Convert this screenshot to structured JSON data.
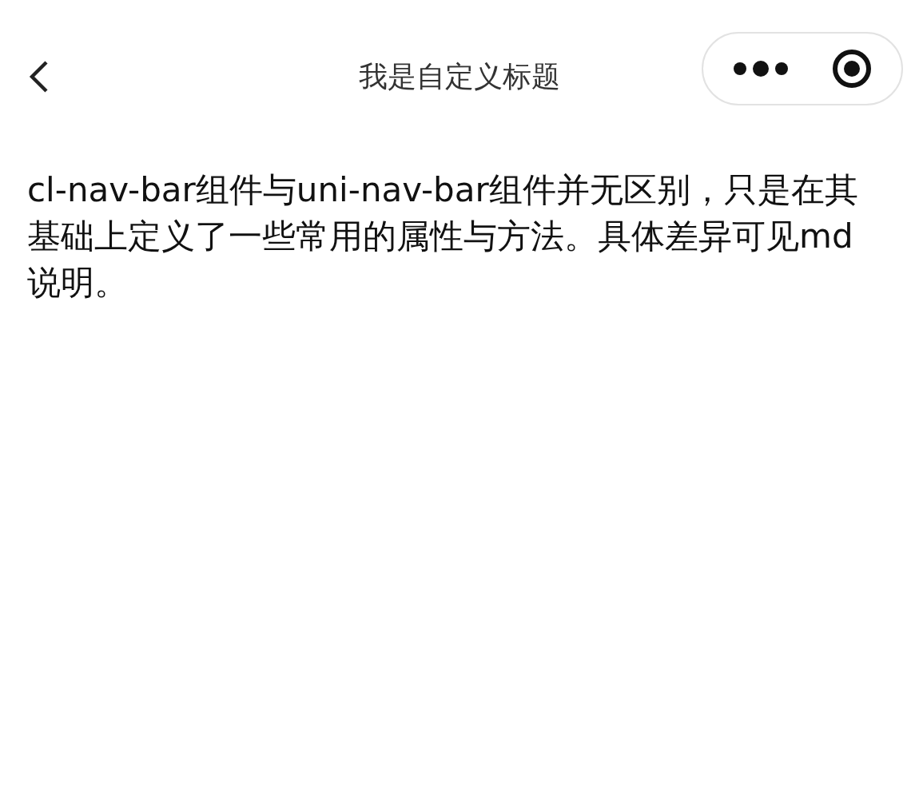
{
  "nav_bar": {
    "title": "我是自定义标题"
  },
  "content": {
    "text": "cl-nav-bar组件与uni-nav-bar组件并无区别，只是在其基础上定义了一些常用的属性与方法。具体差异可见md说明。"
  }
}
